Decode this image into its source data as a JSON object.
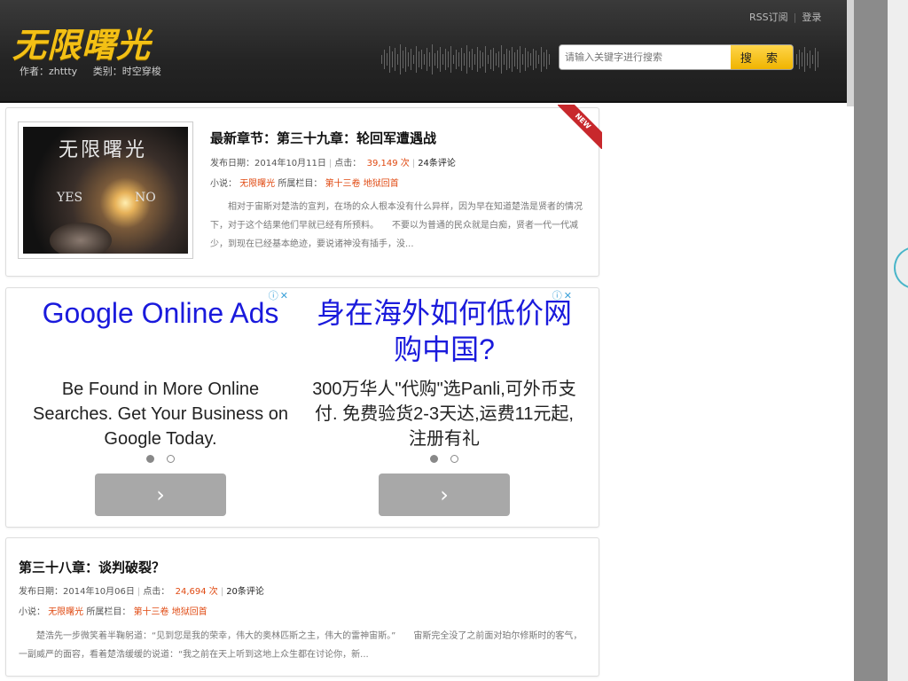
{
  "header": {
    "logo": "无限曙光",
    "author": "作者：zhttty",
    "category": "类别：时空穿梭",
    "rss_label": "RSS订阅",
    "divider": "|",
    "login_label": "登录",
    "search": {
      "placeholder": "请输入关键字进行搜索",
      "button_label": "搜 索"
    }
  },
  "posts": [
    {
      "title": "最新章节：第三十九章：轮回军遭遇战",
      "date_label": "发布日期：2014年10月11日",
      "clicks_label": "点击：",
      "clicks_value": "39,149 次",
      "comments": "24条评论",
      "novel_label": "小说：",
      "novel_name": "无限曙光",
      "column_label": "所属栏目：",
      "column_name": "第十三卷 地狱回首",
      "excerpt": "相对于宙斯对楚浩的宣判，在场的众人根本没有什么异样，因为早在知道楚浩是贤者的情况下，对于这个结果他们早就已经有所预料。　　不要以为普通的民众就是白痴，贤者一代一代减少，到现在已经基本绝迹，要说诸神没有插手，没...",
      "ribbon": "NEW",
      "thumbnail": {
        "title": "无限曙光",
        "yes": "YES",
        "no": "NO"
      }
    },
    {
      "title": "第三十八章：谈判破裂？",
      "date_label": "发布日期：2014年10月06日",
      "clicks_label": "点击：",
      "clicks_value": "24,694 次",
      "comments": "20条评论",
      "novel_label": "小说：",
      "novel_name": "无限曙光",
      "column_label": "所属栏目：",
      "column_name": "第十三卷 地狱回首",
      "excerpt": "楚浩先一步微笑着半鞠躬道：“见到您是我的荣幸，伟大的奥林匹斯之主，伟大的雷神宙斯。”　　宙斯完全没了之前面对珀尔修斯时的客气，一副威严的面容，看着楚浩缓缓的说道：“我之前在天上听到这地上众生都在讨论你，新..."
    }
  ],
  "ads": [
    {
      "headline": "Google Online Ads",
      "body": "Be Found in More Online Searches. Get Your Business on Google Today.",
      "adchoices": "ⓘ✕",
      "arrow": "›"
    },
    {
      "headline": "身在海外如何低价网购中国?",
      "body": "300万华人\"代购\"选Panli,可外币支付. 免费验货2-3天达,运费11元起,注册有礼",
      "adchoices": "ⓘ✕",
      "arrow": "›"
    }
  ]
}
